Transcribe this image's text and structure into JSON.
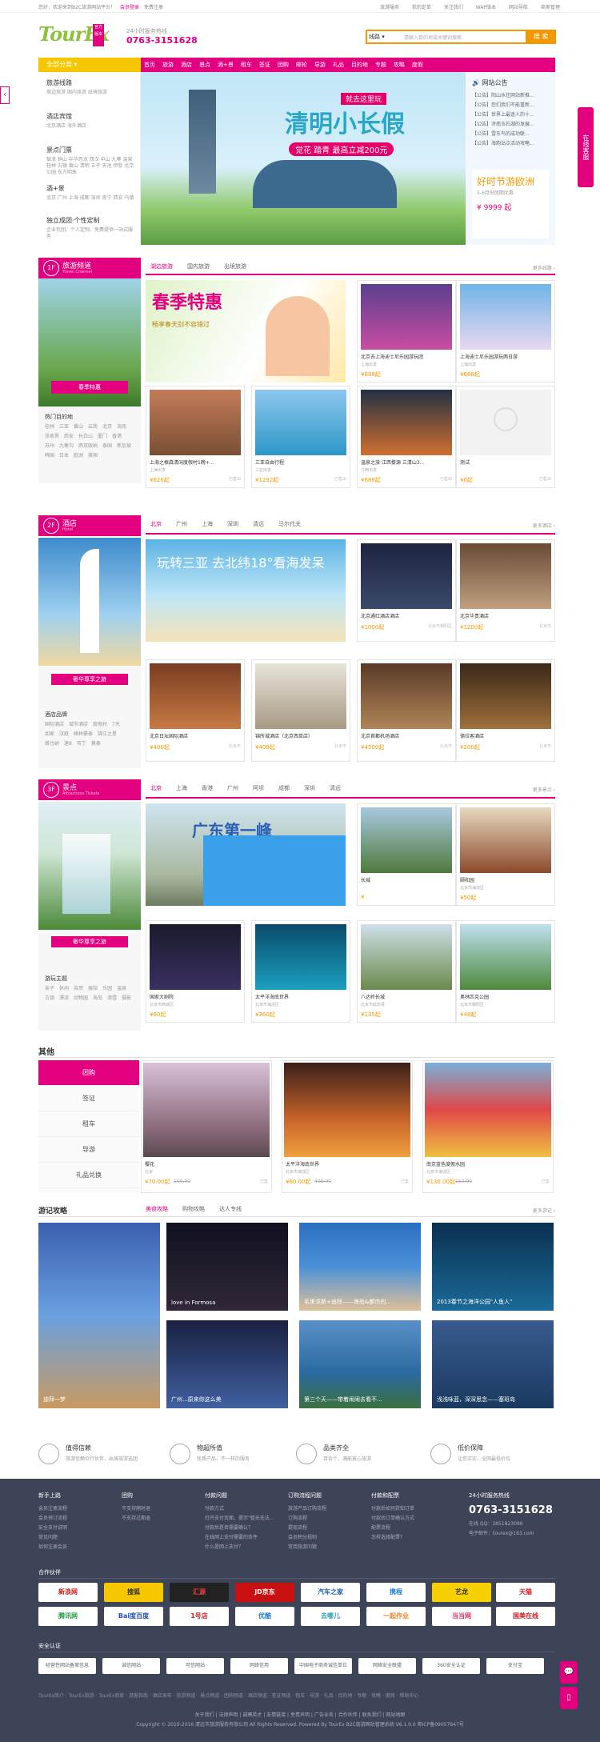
{
  "topbar": {
    "welcome": "您好，欢迎来到B2C旅游网站平台！",
    "login": "会员登录",
    "register": "免费注册",
    "links": [
      "旅游服务",
      "我的定单",
      "关注我们",
      "WAP版本",
      "网站导航",
      "商家管理"
    ]
  },
  "header": {
    "logo": "TourEx",
    "logo_tag": "官方版本",
    "hotline_label": "24小时服务热线",
    "hotline": "0763-3151628",
    "search_type": "线路",
    "search_placeholder": "请输入目的地或关键词搜索",
    "search_btn": "搜 索"
  },
  "nav": {
    "category": "全部分类",
    "items": [
      "首页",
      "旅游",
      "酒店",
      "景点",
      "酒+景",
      "租车",
      "签证",
      "团购",
      "邮轮",
      "导游",
      "礼品",
      "目的地",
      "专题",
      "攻略",
      "度假"
    ]
  },
  "sidebar": [
    {
      "title": "旅游线路",
      "sub": "周边旅游 国内旅游 出境旅游"
    },
    {
      "title": "酒店宾馆",
      "sub": "北京酒店 海外酒店"
    },
    {
      "title": "景点门票",
      "sub": "鼓浪 钟山 中华恐龙 西汉 中山 九寨 温泉 桂林 古镇 黄山 清明 五子 天池 伊犁 北京公园 东方明珠"
    },
    {
      "title": "酒+景",
      "sub": "北京 广州 上海 成都 深圳 南宁 西安 乌镇"
    },
    {
      "title": "独立成团·个性定制",
      "sub": "企业包团、个人定制、免费提供一站式服务"
    }
  ],
  "banner": {
    "title": "清明小长假",
    "tag": "就去这里玩",
    "sub": "觉花 踏青 最高立减200元"
  },
  "notice": {
    "title": "网站公告",
    "items": [
      "【公告】阳山水往网站新推...",
      "【公告】您们我们不能重新...",
      "【公告】世界上最迷人的十...",
      "【公告】济南玉石湖的发展...",
      "【公告】雪东鸟的成功联...",
      "【公告】海韵站点活动攻略..."
    ],
    "promo_title": "好时节游欧洲",
    "promo_sub": "5-6月份团期优惠",
    "promo_price": "¥ 9999 起"
  },
  "online_service": "在线客服",
  "floor1": {
    "num": "1F",
    "name": "旅游频道",
    "en": "Travel Channel",
    "tabs": [
      "湖边旅游",
      "国内旅游",
      "出境旅游"
    ],
    "more": "更多线路 ›",
    "side_heading": "热门目的地",
    "side_tags": [
      "桂林",
      "三亚",
      "黄山",
      "云南",
      "北京",
      "海南",
      "张家界",
      "西安",
      "长白山",
      "厦门",
      "香港",
      "苏州",
      "九寨沟",
      "西双版纳",
      "泰国",
      "新加坡",
      "韩国",
      "日本",
      "欧洲",
      "美国"
    ],
    "promo": "春季特惠",
    "banner_text": "畅享春天别不容错过",
    "cards": [
      {
        "t": "北京去上海迪士尼乐园游玩团",
        "s": "上海出发",
        "p": "¥888起",
        "b": ""
      },
      {
        "t": "上海迪士尼乐园游玩两日游",
        "s": "上海出发",
        "p": "¥888起",
        "b": ""
      },
      {
        "t": "上海之根森清闲度假村1晚+...",
        "s": "上海出发",
        "p": "¥626起",
        "b": "已售出"
      },
      {
        "t": "三亚自由行程",
        "s": "三亚出发",
        "p": "¥1292起",
        "b": "已售出"
      },
      {
        "t": "温泉之旅·江西婺源·三清山3...",
        "s": "江西出发",
        "p": "¥688起",
        "b": "已售出"
      },
      {
        "t": "测试",
        "s": "",
        "p": "¥0起",
        "b": "已售出"
      }
    ]
  },
  "floor2": {
    "num": "2F",
    "name": "酒店",
    "en": "Hotel",
    "tabs": [
      "北京",
      "广州",
      "上海",
      "深圳",
      "清远",
      "马尔代夫"
    ],
    "more": "更多酒店 ›",
    "side_heading": "酒店品牌",
    "side_tags": [
      "国际酒店",
      "城市酒店",
      "度假村",
      "7天",
      "如家",
      "汉庭",
      "格林豪泰",
      "锦江之星",
      "维也纳",
      "速8",
      "布丁",
      "莫泰"
    ],
    "side_promo": "奢华尊享之旅",
    "banner_text": "玩转三亚 去北纬18°看海发呆",
    "cards": [
      {
        "t": "北京通红酒店酒店",
        "s": "",
        "p": "¥1000起",
        "b": "北京市朝阳区"
      },
      {
        "t": "北京华贵酒店",
        "s": "",
        "p": "¥1200起",
        "b": "北京市"
      },
      {
        "t": "北京日坛国际酒店",
        "s": "",
        "p": "¥400起",
        "b": "北京市"
      },
      {
        "t": "锦所城酒店（北京西单店）",
        "s": "",
        "p": "¥408起",
        "b": "北京市"
      },
      {
        "t": "北京首都机场酒店",
        "s": "",
        "p": "¥4500起",
        "b": "北京市"
      },
      {
        "t": "德拉客酒店",
        "s": "",
        "p": "¥200起",
        "b": "北京市"
      }
    ]
  },
  "floor3": {
    "num": "3F",
    "name": "景点",
    "en": "Attractions Tickets",
    "tabs": [
      "北京",
      "上海",
      "香港",
      "广州",
      "阿坝",
      "成都",
      "深圳",
      "清远"
    ],
    "more": "更多景点 ›",
    "side_heading": "游玩主题",
    "side_tags": [
      "亲子",
      "休闲",
      "自然",
      "展馆",
      "乐园",
      "温泉",
      "古镇",
      "漂流",
      "动物园",
      "海岛",
      "滑雪",
      "摄影"
    ],
    "side_promo": "奢华尊享之旅",
    "banner_text": "广东第一峰",
    "cards": [
      {
        "t": "长城",
        "s": "",
        "p": "¥",
        "b": ""
      },
      {
        "t": "颐和园",
        "s": "北京市海淀区",
        "p": "¥50起",
        "b": ""
      },
      {
        "t": "国家大剧院",
        "s": "北京市西城区",
        "p": "¥60起",
        "b": ""
      },
      {
        "t": "太平洋海底世界",
        "s": "北京市海淀区",
        "p": "¥360起",
        "b": ""
      },
      {
        "t": "八达岭长城",
        "s": "北京市延庆县",
        "p": "¥135起",
        "b": ""
      },
      {
        "t": "奥林匹克公园",
        "s": "北京市朝阳区",
        "p": "¥48起",
        "b": ""
      }
    ]
  },
  "other": {
    "heading": "其他",
    "nav": [
      "团购",
      "签证",
      "租车",
      "导游",
      "礼品兑换"
    ],
    "cards": [
      {
        "t": "樱花",
        "s": "北京",
        "p": "¥70.00起",
        "op": "100.00",
        "b": "已售"
      },
      {
        "t": "太平洋海底世界",
        "s": "北京市海淀区",
        "p": "¥60.00起",
        "op": "405.00",
        "b": "已售"
      },
      {
        "t": "南京蓝色度假水园",
        "s": "北京市海淀区",
        "p": "¥130.00起",
        "op": "150.00",
        "b": "已售"
      }
    ]
  },
  "travel": {
    "heading": "游记攻略",
    "tabs": [
      "美食攻略",
      "购物攻略",
      "达人专线"
    ],
    "more": "更多游记 ›",
    "tiles": [
      "迪拜一梦",
      "love in Formosa",
      "毛里求斯+迪拜——海岛&都市的...",
      "2013春节之海洋公园\"人鱼人\"",
      "广州...原来你这么美",
      "第三个天——带着闹闹去看不...",
      "浅浅咏蓝，深深思念——塞班岛"
    ]
  },
  "services": [
    {
      "t": "值得信赖",
      "d": "旅游信赖众行伙伴，出境旅游选团"
    },
    {
      "t": "物超所值",
      "d": "优质产品，不一样的服务"
    },
    {
      "t": "品类齐全",
      "d": "百余个，满能放心旅游"
    },
    {
      "t": "低价保障",
      "d": "让您买实，全网最低价位"
    }
  ],
  "footer": {
    "cols": [
      {
        "h": "新手上路",
        "l": [
          "会员注册流程",
          "会员预订流程",
          "安全支付说明",
          "常见问题",
          "如何注册会员"
        ]
      },
      {
        "h": "团购",
        "l": [
          "不支持随时退",
          "不支持过期退"
        ]
      },
      {
        "h": "付款问题",
        "l": [
          "付款方式",
          "打开支付页面，提示\"暂无无法...",
          "付款后是否需要确认？",
          "在线网上支付需要的条件",
          "什么是网上支付？"
        ]
      },
      {
        "h": "订购流程问题",
        "l": [
          "旅游产品订购流程",
          "订购流程",
          "提现流程",
          "会员积分规则",
          "常用旅游问题"
        ]
      },
      {
        "h": "付款和配票",
        "l": [
          "付款后如何获知订单",
          "付款后订单确认方式",
          "配票流程",
          "怎样选择配票？"
        ]
      }
    ],
    "hot_label": "24小时服务热线",
    "hotline": "0763-3151628",
    "qq": "在线 QQ：2851823096",
    "email": "电子邮件：tourex@163.com",
    "partners_label": "合作伙伴",
    "partners": [
      "新浪网",
      "搜狐",
      "汇源",
      "JD京东",
      "汽车之家",
      "携程",
      "艺龙",
      "天猫",
      "腾讯网",
      "Bai度百度",
      "1号店",
      "优酷",
      "去哪儿",
      "一起作业",
      "当当网",
      "国美在线"
    ],
    "certs_label": "安全认证",
    "certs": [
      "经营性网站备案信息",
      "诚信网站",
      "可信网站",
      "网络信用",
      "中国电子商务诚信单位",
      "网络安全联盟",
      "360安全认证",
      "支付宝"
    ],
    "bottom_links": [
      "TourEx简介",
      "TourEx旅游",
      "TourEx商家",
      "游客指南",
      "酒店发布",
      "旅游频道",
      "景点频道",
      "团购频道",
      "酒店频道",
      "签证频道",
      "租车",
      "导游",
      "礼品",
      "目的地",
      "专题",
      "攻略",
      "度假",
      "帮助中心"
    ],
    "links_row": [
      "关于我们",
      "法律声明",
      "诚聘英才",
      "友情链接",
      "免责声明",
      "广告业务",
      "合作伙伴",
      "联系我们",
      "网站地图"
    ],
    "copyright": "Copyright © 2010-2016 清远市旅游服务有限公司 All Rights Reserved. Powered By TourEx B2C旅游网站管理系统 V6.1.0.0 粤ICP备09057647号"
  }
}
